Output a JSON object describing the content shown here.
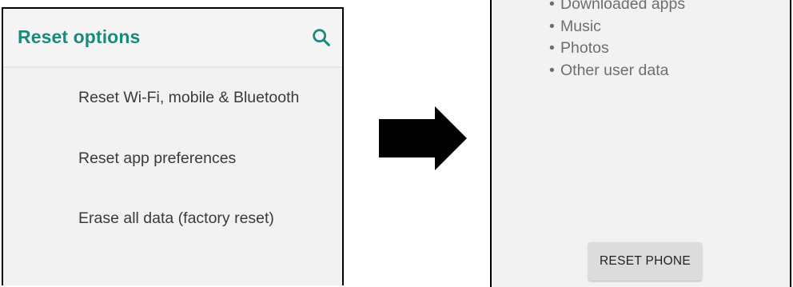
{
  "left_screen": {
    "title": "Reset options",
    "search_icon": "search-icon",
    "items": [
      {
        "label": "Reset Wi-Fi, mobile & Bluetooth"
      },
      {
        "label": "Reset app preferences"
      },
      {
        "label": "Erase all data (factory reset)"
      }
    ]
  },
  "arrow": {
    "icon": "right-arrow-icon",
    "color": "#000000"
  },
  "right_screen": {
    "data_items": [
      {
        "label": "Downloaded apps"
      },
      {
        "label": "Music"
      },
      {
        "label": "Photos"
      },
      {
        "label": "Other user data"
      }
    ],
    "bullet": "•",
    "reset_button_label": "RESET PHONE"
  },
  "colors": {
    "accent": "#1a8a7c",
    "screen_background": "#f2f2f2",
    "button_background": "#dcdcdc"
  }
}
